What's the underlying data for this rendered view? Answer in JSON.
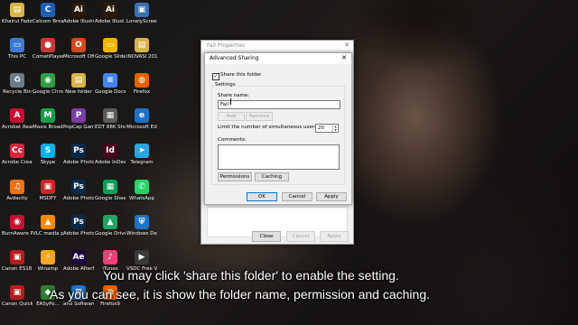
{
  "desktop": {
    "icons": [
      {
        "label": "Khairul Fadzli Ramli",
        "icon": "folder-icon",
        "color": "#d9b44a",
        "glyph": "▤"
      },
      {
        "label": "Celcom Broadba...",
        "icon": "celcom-icon",
        "color": "#1f5fb4",
        "glyph": "C"
      },
      {
        "label": "Adobe Illustrat...",
        "icon": "adobe-illustrator-icon",
        "color": "#2b1a07",
        "glyph": "Ai"
      },
      {
        "label": "Adobe Illust.ator...",
        "icon": "adobe-illustrator-icon",
        "color": "#2b1a07",
        "glyph": "Ai"
      },
      {
        "label": "LonelyScreen",
        "icon": "lonelyscreen-icon",
        "color": "#3a6fb0",
        "glyph": "▣"
      },
      {
        "label": "This PC",
        "icon": "this-pc-icon",
        "color": "#3d7ad6",
        "glyph": "▭"
      },
      {
        "label": "CometPlayer",
        "icon": "cometplayer-icon",
        "color": "#c73838",
        "glyph": "●"
      },
      {
        "label": "Microsoft Office",
        "icon": "microsoft-office-icon",
        "color": "#d04a1c",
        "glyph": "O"
      },
      {
        "label": "Google Slides",
        "icon": "google-slides-icon",
        "color": "#f4b400",
        "glyph": "▭"
      },
      {
        "label": "INOVASI 2016",
        "icon": "folder-icon",
        "color": "#d9b44a",
        "glyph": "▤"
      },
      {
        "label": "Recycle Bin",
        "icon": "recycle-bin-icon",
        "color": "#6a7c8c",
        "glyph": "♻"
      },
      {
        "label": "Google Chrome",
        "icon": "chrome-icon",
        "color": "#2f9e44",
        "glyph": "◉"
      },
      {
        "label": "New folder",
        "icon": "folder-icon",
        "color": "#d9b44a",
        "glyph": "▤"
      },
      {
        "label": "Google Docs",
        "icon": "google-docs-icon",
        "color": "#4285f4",
        "glyph": "≡"
      },
      {
        "label": "Firefox",
        "icon": "firefox-icon",
        "color": "#e66000",
        "glyph": "◍"
      },
      {
        "label": "Acrobat Reader DC",
        "icon": "acrobat-icon",
        "color": "#c8102e",
        "glyph": "A"
      },
      {
        "label": "Maxis Broadband",
        "icon": "maxis-icon",
        "color": "#1a9d4b",
        "glyph": "M"
      },
      {
        "label": "PopCap Games",
        "icon": "popcap-icon",
        "color": "#7a3fa0",
        "glyph": "P"
      },
      {
        "label": "EDT 88K Shortcut",
        "icon": "shortcut-icon",
        "color": "#5a5a5a",
        "glyph": "▦"
      },
      {
        "label": "Microsoft Edge",
        "icon": "edge-icon",
        "color": "#1e73c8",
        "glyph": "e"
      },
      {
        "label": "Acrobe Creati...",
        "icon": "adobe-creative-cloud-icon",
        "color": "#d7263d",
        "glyph": "Cc"
      },
      {
        "label": "Skype",
        "icon": "skype-icon",
        "color": "#00aff0",
        "glyph": "S"
      },
      {
        "label": "Adobe Photosh...",
        "icon": "adobe-photoshop-icon",
        "color": "#0b2a4a",
        "glyph": "Ps"
      },
      {
        "label": "Adobe InDesi...",
        "icon": "adobe-indesign-icon",
        "color": "#49021f",
        "glyph": "Id"
      },
      {
        "label": "Telegram",
        "icon": "telegram-icon",
        "color": "#2ca5e0",
        "glyph": "➤"
      },
      {
        "label": "Avdacity",
        "icon": "audacity-icon",
        "color": "#e8731a",
        "glyph": "♫"
      },
      {
        "label": "MSDFY",
        "icon": "msdfy-icon",
        "color": "#c62828",
        "glyph": "▣"
      },
      {
        "label": "Adobe Photosh...",
        "icon": "adobe-photoshop-icon",
        "color": "#0b2a4a",
        "glyph": "Ps"
      },
      {
        "label": "Google Sheets",
        "icon": "google-sheets-icon",
        "color": "#0f9d58",
        "glyph": "▦"
      },
      {
        "label": "WhatsApp",
        "icon": "whatsapp-icon",
        "color": "#25d366",
        "glyph": "✆"
      },
      {
        "label": "BurnAware Professional",
        "icon": "burnaware-icon",
        "color": "#c8102e",
        "glyph": "◉"
      },
      {
        "label": "VLC media player",
        "icon": "vlc-icon",
        "color": "#ff8800",
        "glyph": "▲"
      },
      {
        "label": "Adobe Photosh...",
        "icon": "adobe-photoshop-icon",
        "color": "#0b2a4a",
        "glyph": "Ps"
      },
      {
        "label": "Google Drive",
        "icon": "google-drive-icon",
        "color": "#1fa463",
        "glyph": "▲"
      },
      {
        "label": "Windows Defend...",
        "icon": "windows-defender-icon",
        "color": "#1e73c8",
        "glyph": "⛨"
      },
      {
        "label": "Canon ES18 sories On...",
        "icon": "canon-icon",
        "color": "#b71c1c",
        "glyph": "▣"
      },
      {
        "label": "Winamp",
        "icon": "winamp-icon",
        "color": "#f5a623",
        "glyph": "⚡"
      },
      {
        "label": "Adobe AfterFX 2018",
        "icon": "adobe-aftereffects-icon",
        "color": "#1f0740",
        "glyph": "Ae"
      },
      {
        "label": "iTunes",
        "icon": "itunes-icon",
        "color": "#e9407a",
        "glyph": "♪"
      },
      {
        "label": "VSDC Free Video Editor",
        "icon": "vsdc-icon",
        "color": "#3a3a3a",
        "glyph": "▶"
      },
      {
        "label": "Canon Quick Menu",
        "icon": "canon-icon",
        "color": "#b71c1c",
        "glyph": "▣"
      },
      {
        "label": "EASyPo...",
        "icon": "easypo-icon",
        "color": "#2e7d32",
        "glyph": "◆"
      },
      {
        "label": "and Software",
        "icon": "windows-icon",
        "color": "#1e73c8",
        "glyph": "⊞"
      },
      {
        "label": "Firefox9",
        "icon": "firefox-icon",
        "color": "#e66000",
        "glyph": "◍"
      }
    ]
  },
  "properties_dialog": {
    "title": "Fail Properties",
    "close_label": "✕",
    "buttons": {
      "close": "Close",
      "cancel": "Cancel",
      "apply": "Apply"
    }
  },
  "advanced_sharing": {
    "title": "Advanced Sharing",
    "close_label": "✕",
    "share_checkbox_label": "Share this folder",
    "share_checked": true,
    "settings_label": "Settings",
    "share_name_label": "Share name:",
    "share_name_value": "Fail",
    "add_label": "Add",
    "remove_label": "Remove",
    "limit_label": "Limit the number of simultaneous users to:",
    "limit_value": "20",
    "comments_label": "Comments:",
    "comments_value": "",
    "permissions_label": "Permissions",
    "caching_label": "Caching",
    "ok_label": "OK",
    "cancel_label": "Cancel",
    "apply_label": "Apply"
  },
  "captions": {
    "line1": "You may click 'share this folder' to enable the setting.",
    "line2": "As you can see, it is show the folder name, permission and caching."
  }
}
